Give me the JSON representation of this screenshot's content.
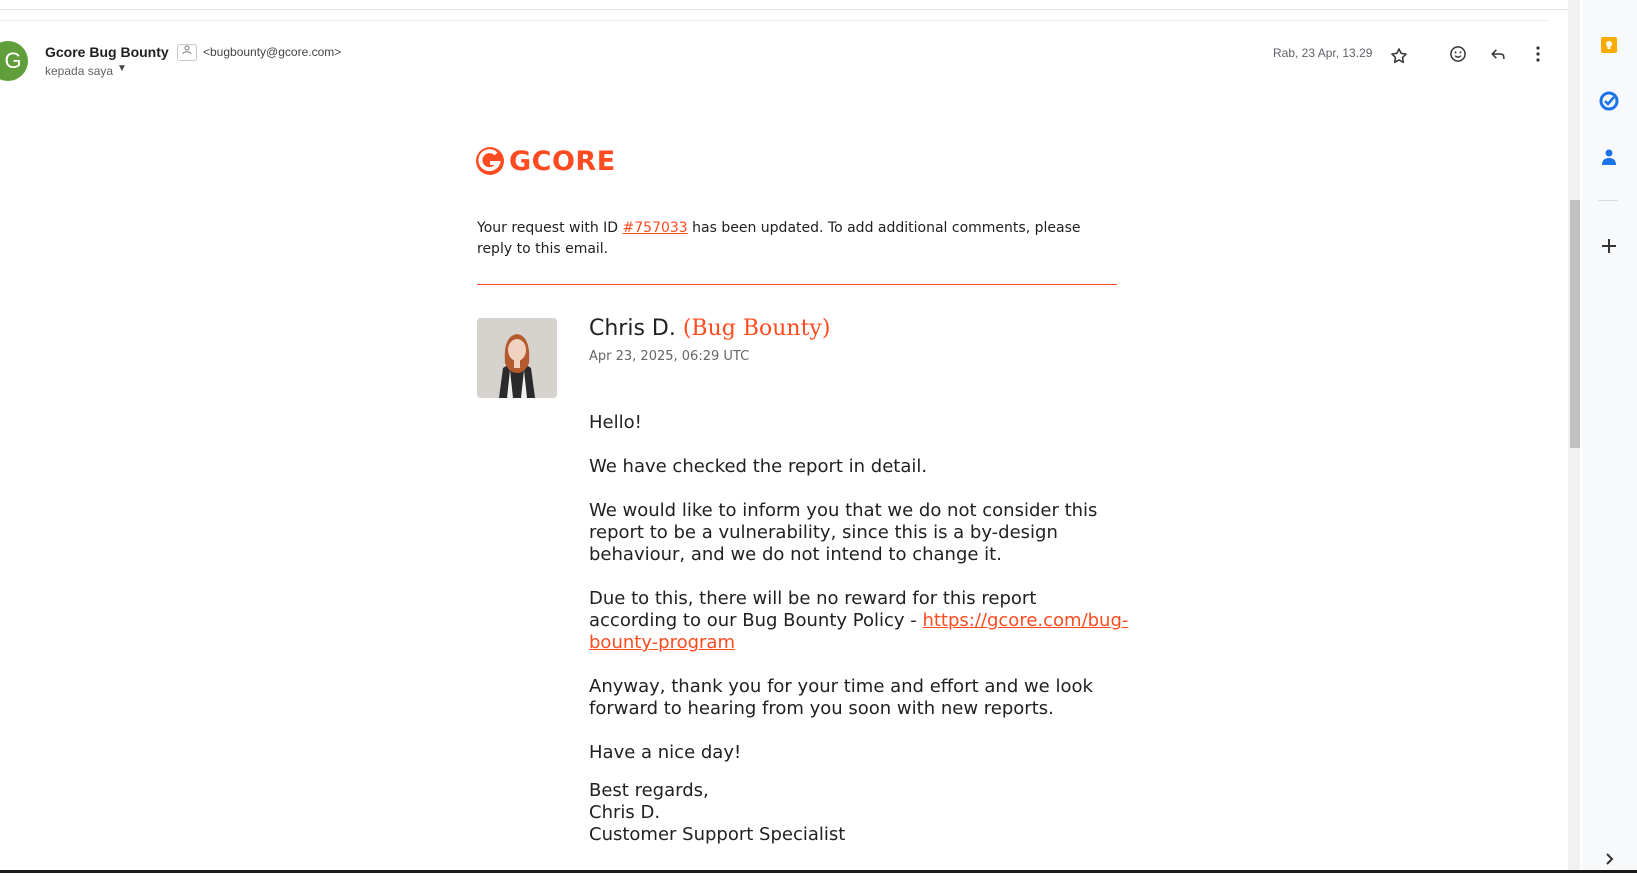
{
  "header": {
    "avatar_letter": "G",
    "sender_name": "Gcore Bug Bounty",
    "sender_email": "<bugbounty@gcore.com>",
    "recipient": "kepada saya",
    "date": "Rab, 23 Apr, 13.29"
  },
  "icons": {
    "star": "star-icon",
    "emoji": "emoji-icon",
    "reply": "reply-icon",
    "more": "more-vert-icon",
    "keep": "keep-icon",
    "tasks": "tasks-icon",
    "contacts": "contacts-icon",
    "add": "add-icon",
    "expand": "chevron-right-icon"
  },
  "email": {
    "logo_text": "GCORE",
    "intro_before": "Your request with ID ",
    "request_id": "#757033",
    "intro_after": " has been updated. To add additional comments, please reply to this email.",
    "agent_name": "Chris D. ",
    "agent_role": "(Bug Bounty)",
    "agent_time": "Apr 23, 2025, 06:29 UTC",
    "p1": "Hello!",
    "p2": "We have checked the report in detail.",
    "p3": "We would like to inform you that we do not consider this report to be a vulnerability, since this is a by-design behaviour, and we do not intend to change it.",
    "p4": "Due to this, there will be no reward for this report according to our Bug Bounty Policy - ",
    "p4_link": "https://gcore.com/bug-bounty-program",
    "p5": "Anyway, thank you for your time and effort and we look forward to hearing from you soon with new reports.",
    "p6": "Have a nice day!",
    "sig1": "Best regards,",
    "sig2": "Chris D.",
    "sig3": "Customer Support Specialist"
  },
  "colors": {
    "brand": "#ff4b1f",
    "avatar_bg": "#5f9e3a"
  }
}
